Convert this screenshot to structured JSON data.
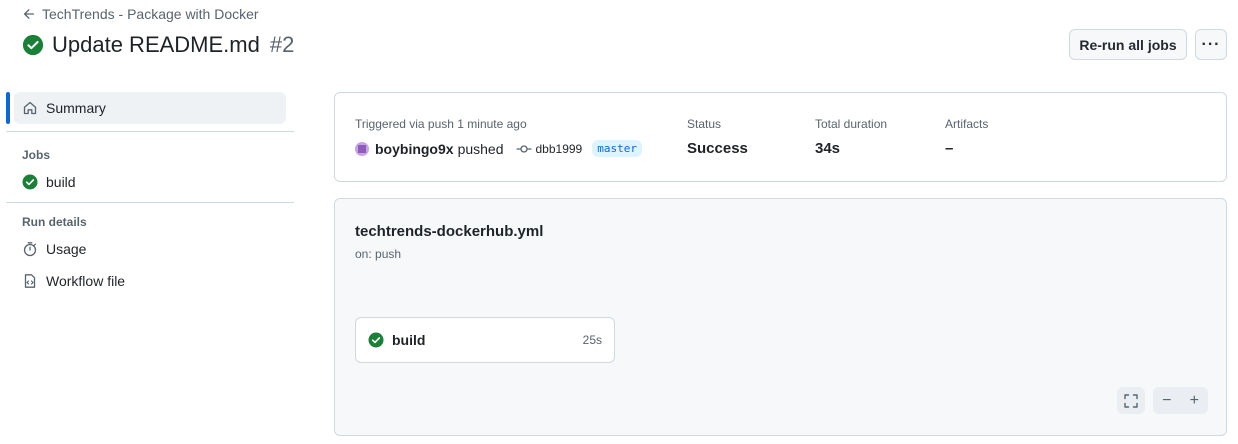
{
  "header": {
    "back_label": "TechTrends - Package with Docker",
    "title": "Update README.md",
    "run_number": "#2",
    "rerun_label": "Re-run all jobs",
    "more_label": "···"
  },
  "sidebar": {
    "summary_label": "Summary",
    "jobs_heading": "Jobs",
    "jobs": [
      {
        "label": "build",
        "status": "success"
      }
    ],
    "run_details_heading": "Run details",
    "usage_label": "Usage",
    "workflow_file_label": "Workflow file"
  },
  "summary": {
    "trigger_label": "Triggered via push 1 minute ago",
    "user": "boybingo9x",
    "action": "pushed",
    "commit": "dbb1999",
    "branch": "master",
    "status_label": "Status",
    "status_value": "Success",
    "duration_label": "Total duration",
    "duration_value": "34s",
    "artifacts_label": "Artifacts",
    "artifacts_value": "–"
  },
  "graph": {
    "workflow_name": "techtrends-dockerhub.yml",
    "trigger": "on: push",
    "job_name": "build",
    "job_duration": "25s",
    "zoom_out": "−",
    "zoom_in": "+"
  },
  "colors": {
    "success": "#1a7f37",
    "accent": "#0969da"
  }
}
